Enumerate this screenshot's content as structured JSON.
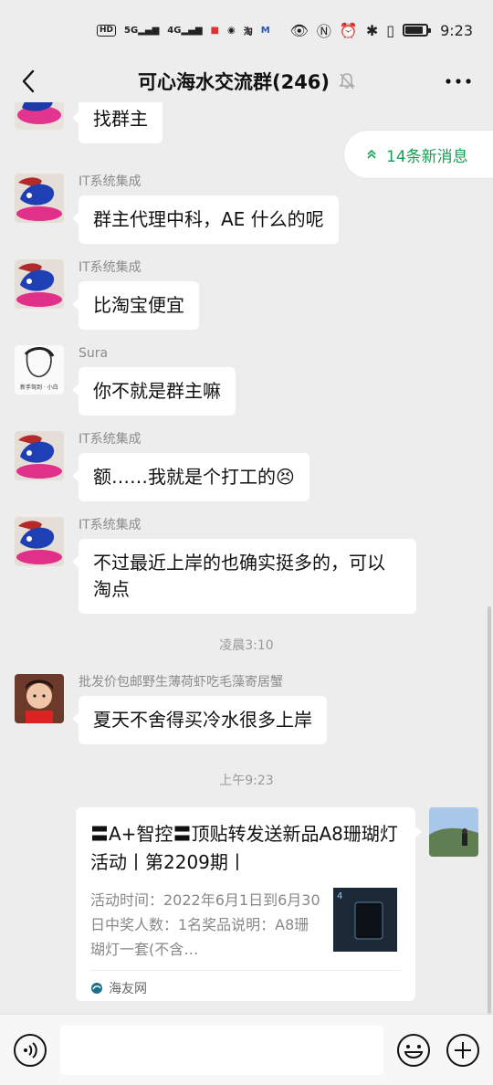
{
  "status_bar": {
    "left_icons": [
      "HD-icon",
      "5G-icon",
      "4G-icon",
      "app-icons"
    ],
    "time": "9:23"
  },
  "header": {
    "title": "可心海水交流群(246)"
  },
  "new_messages": {
    "label": "14条新消息"
  },
  "messages": [
    {
      "sender": "",
      "text": "找群主",
      "avatar": "dino"
    },
    {
      "sender": "IT系统集成",
      "text": "群主代理中科，AE 什么的呢",
      "avatar": "dino"
    },
    {
      "sender": "IT系统集成",
      "text": "比淘宝便宜",
      "avatar": "dino"
    },
    {
      "sender": "Sura",
      "text": "你不就是群主嘛",
      "avatar": "sketch"
    },
    {
      "sender": "IT系统集成",
      "text": "额……我就是个打工的😣",
      "avatar": "dino"
    },
    {
      "sender": "IT系统集成",
      "text": "不过最近上岸的也确实挺多的，可以淘点",
      "avatar": "dino"
    },
    {
      "sender": "批发价包邮野生薄荷虾吃毛藻寄居蟹",
      "text": "夏天不舍得买冷水很多上岸",
      "avatar": "girl"
    }
  ],
  "timestamps": [
    "凌晨3:10",
    "上午9:23"
  ],
  "link_card": {
    "title": "〓A+智控〓顶贴转发送新品A8珊瑚灯活动丨第2209期丨",
    "description": "活动时间：2022年6月1日到6月30日中奖人数：1名奖品说明：A8珊瑚灯一套(不含…",
    "source": "海友网"
  },
  "colors": {
    "background": "#ededed",
    "accent_green": "#13a057"
  }
}
